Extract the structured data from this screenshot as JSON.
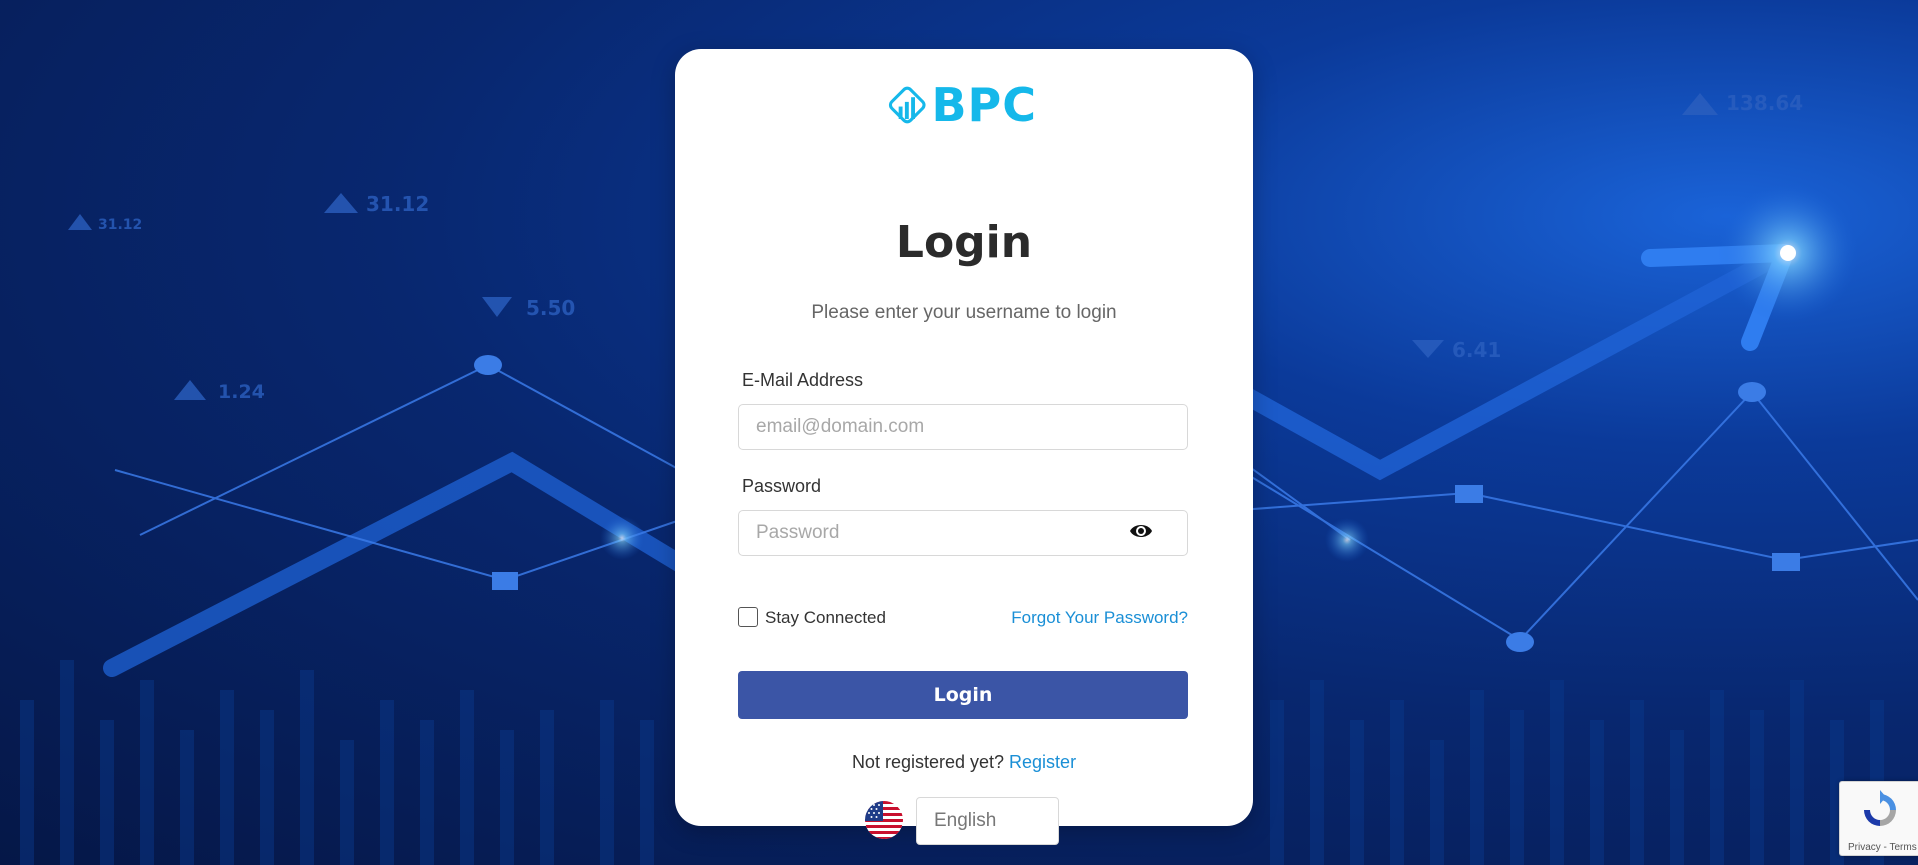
{
  "brand": {
    "logo_text": "BPC",
    "logo_color": "#15b8ea"
  },
  "login": {
    "title": "Login",
    "subtitle": "Please enter your username to login",
    "email_label": "E-Mail Address",
    "email_placeholder": "email@domain.com",
    "password_label": "Password",
    "password_placeholder": "Password",
    "stay_connected_label": "Stay Connected",
    "stay_connected_checked": false,
    "forgot_link": "Forgot Your Password?",
    "submit_label": "Login",
    "not_registered_text": "Not registered yet?",
    "register_link": "Register"
  },
  "language": {
    "flag_icon": "us-flag-icon",
    "selected": "English"
  },
  "recaptcha": {
    "footer_text": "Privacy - Terms"
  },
  "background": {
    "tickers": [
      "31.12",
      "31.12",
      "5.50",
      "1.24",
      "138.64",
      "6.41"
    ]
  },
  "colors": {
    "primary_button": "#3b55a6",
    "link": "#1a8fd6"
  }
}
